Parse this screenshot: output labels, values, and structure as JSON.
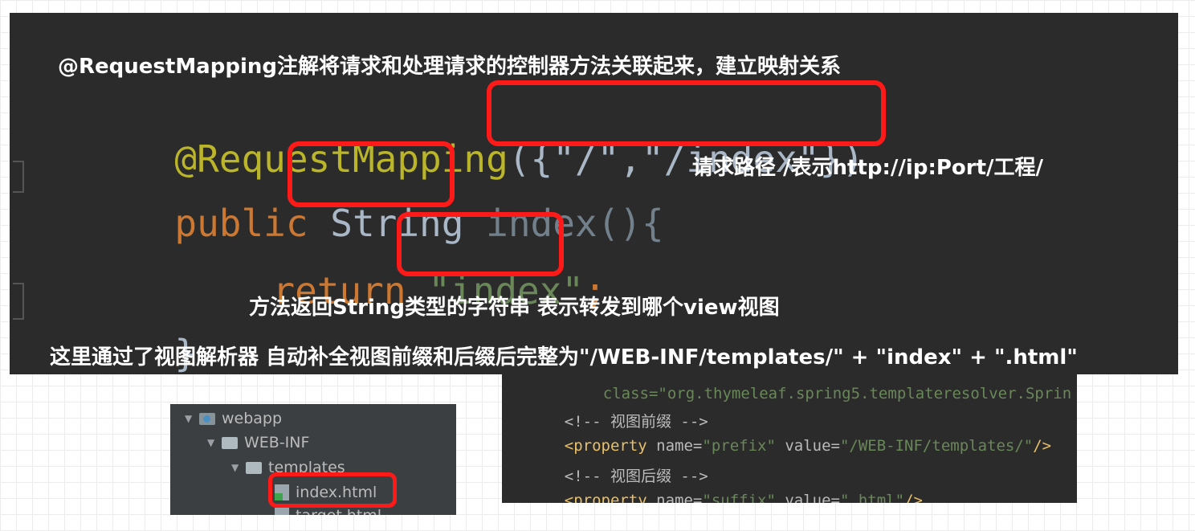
{
  "heading": "@RequestMapping注解将请求和处理请求的控制器方法关联起来，建立映射关系",
  "code": {
    "line1_annotation": "@RequestMapping",
    "line1_args": "({\"/\",\"/index\"})",
    "line2_kw": "public",
    "line2_type": "String",
    "line2_method": "index(){",
    "line3_kw": "return",
    "line3_str": "\"index\"",
    "line3_semicolon": ";",
    "line4_brace": "}"
  },
  "notes": {
    "path_note": "请求路径 /表示http://ip:Port/工程/",
    "return_note": "方法返回String类型的字符串 表示转发到哪个view视图",
    "resolver_note": "这里通过了视图解析器 自动补全视图前缀和后缀后完整为\"/WEB-INF/templates/\" + \"index\" + \".html\""
  },
  "project_tree": {
    "items": [
      {
        "label": "webapp"
      },
      {
        "label": "WEB-INF"
      },
      {
        "label": "templates"
      },
      {
        "label": "index.html"
      },
      {
        "label": "target.html"
      }
    ]
  },
  "xml_config": {
    "cut_line": "class=\"org.thymeleaf.spring5.templateresolver.Sprin",
    "comment_prefix": "<!-- 视图前缀 -->",
    "prefix_tag": "<property",
    "prefix_name_attr": "name=",
    "prefix_name_val": "\"prefix\"",
    "prefix_value_attr": "value=",
    "prefix_value_val": "\"/WEB-INF/templates/\"",
    "prefix_close": "/>",
    "comment_suffix": "<!-- 视图后缀 -->",
    "suffix_tag": "<property",
    "suffix_name_attr": "name=",
    "suffix_name_val": "\"suffix\"",
    "suffix_value_attr": "value=",
    "suffix_value_val": "\".html\"",
    "suffix_close": "/>"
  },
  "colors": {
    "highlight_box": "#ff1a1a",
    "editor_bg": "#2b2b2b",
    "annotation": "#bbb529",
    "keyword": "#cc7832",
    "string": "#6a8759"
  }
}
